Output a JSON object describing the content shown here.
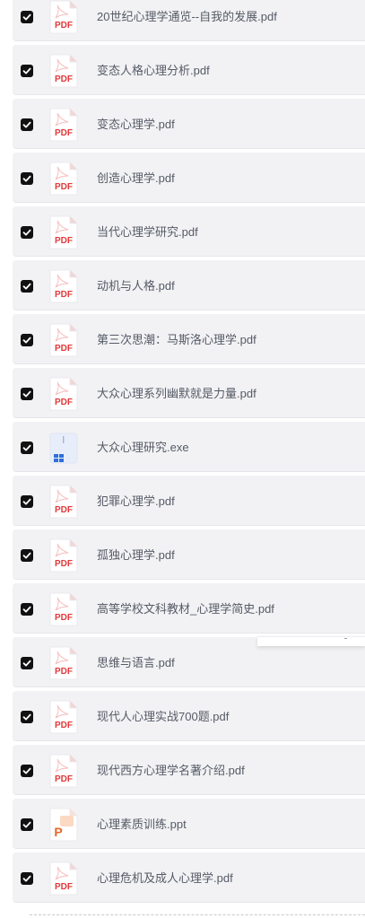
{
  "files": [
    {
      "name": "20世纪心理学通览--自我的发展.pdf",
      "type": "pdf",
      "checked": true
    },
    {
      "name": "变态人格心理分析.pdf",
      "type": "pdf",
      "checked": true
    },
    {
      "name": "变态心理学.pdf",
      "type": "pdf",
      "checked": true
    },
    {
      "name": "创造心理学.pdf",
      "type": "pdf",
      "checked": true
    },
    {
      "name": "当代心理学研究.pdf",
      "type": "pdf",
      "checked": true
    },
    {
      "name": "动机与人格.pdf",
      "type": "pdf",
      "checked": true
    },
    {
      "name": "第三次思潮：马斯洛心理学.pdf",
      "type": "pdf",
      "checked": true
    },
    {
      "name": "大众心理系列幽默就是力量.pdf",
      "type": "pdf",
      "checked": true
    },
    {
      "name": "大众心理研究.exe",
      "type": "exe",
      "checked": true
    },
    {
      "name": "犯罪心理学.pdf",
      "type": "pdf",
      "checked": true
    },
    {
      "name": "孤独心理学.pdf",
      "type": "pdf",
      "checked": true
    },
    {
      "name": "高等学校文科教材_心理学简史.pdf",
      "type": "pdf",
      "checked": true
    },
    {
      "name": "思维与语言.pdf",
      "type": "pdf",
      "checked": true
    },
    {
      "name": "现代人心理实战700题.pdf",
      "type": "pdf",
      "checked": true
    },
    {
      "name": "现代西方心理学名著介绍.pdf",
      "type": "pdf",
      "checked": true
    },
    {
      "name": "心理素质训练.ppt",
      "type": "ppt",
      "checked": true
    },
    {
      "name": "心理危机及成人心理学.pdf",
      "type": "pdf",
      "checked": true
    }
  ],
  "icons": {
    "pdf": {
      "label": "PDF",
      "color": "#e2383a"
    },
    "ppt": {
      "label": "P",
      "color": "#e8672a"
    },
    "exe": {
      "color": "#2f6fd6"
    }
  },
  "checkbox_icon": "checkmark-icon"
}
